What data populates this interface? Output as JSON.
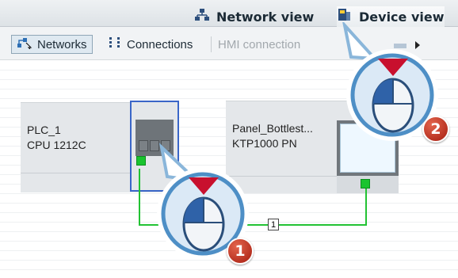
{
  "views": {
    "network_label": "Network view",
    "device_label": "Device view"
  },
  "toolbar": {
    "networks_label": "Networks",
    "connections_label": "Connections",
    "connection_type_value": "HMI connection"
  },
  "devices": [
    {
      "name": "PLC_1",
      "type": "CPU 1212C"
    },
    {
      "name": "Panel_Bottlest...",
      "type": "KTP1000 PN"
    }
  ],
  "connection": {
    "label": "1"
  },
  "callouts": {
    "step1": "1",
    "step2": "2"
  },
  "icons": {
    "network_view": "network-view-icon",
    "device_view": "device-view-icon",
    "networks": "networks-icon",
    "connections": "connections-icon",
    "mouse": "mouse-click-icon"
  },
  "colors": {
    "selection_border": "#3a66c8",
    "network_wire": "#22c233",
    "callout_badge": "#c0321e",
    "click_arrow": "#c8102e"
  }
}
